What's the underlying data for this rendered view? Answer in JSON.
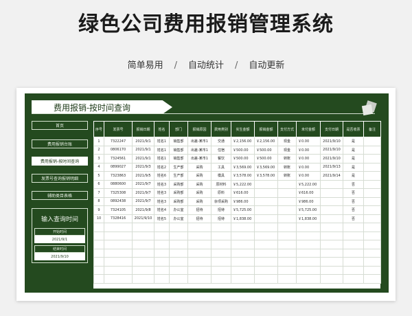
{
  "header": {
    "title": "绿色公司费用报销管理系统",
    "features": [
      "简单易用",
      "自动统计",
      "自动更新"
    ],
    "separator": "/"
  },
  "app": {
    "banner_title": "费用报销-按时间查询",
    "sidebar": {
      "items": [
        {
          "label": "首页",
          "active": false
        },
        {
          "label": "费用报销台账",
          "active": false
        },
        {
          "label": "费用报销-按时间查询",
          "active": true
        },
        {
          "label": "发票号查询报销明细",
          "active": false
        },
        {
          "label": "辅助类目表格",
          "active": false
        }
      ],
      "query": {
        "title": "输入查询时间",
        "start_label": "开始时间",
        "start_value": "2021/9/1",
        "end_label": "结束时间",
        "end_value": "2021/9/10"
      }
    },
    "table": {
      "headers": [
        "序号",
        "发票号",
        "报销日期",
        "姓名",
        "部门",
        "报销原因",
        "费用类别",
        "实生金额",
        "报销金额",
        "支付方式",
        "未付金额",
        "支付日期",
        "是否收票",
        "备注"
      ],
      "rows": [
        [
          "1",
          "7322247",
          "2021/9/1",
          "姓名1",
          "销售部",
          "出差-某市1",
          "交通",
          "￥2,156.00",
          "￥2,156.00",
          "现金",
          "￥0.00",
          "2021/9/10",
          "是",
          ""
        ],
        [
          "2",
          "0806170",
          "2021/9/1",
          "姓名1",
          "销售部",
          "出差-某市1",
          "住宿",
          "￥500.00",
          "￥500.00",
          "现金",
          "￥0.00",
          "2021/9/10",
          "是",
          ""
        ],
        [
          "3",
          "7324561",
          "2021/9/1",
          "姓名1",
          "销售部",
          "出差-某市1",
          "餐饮",
          "￥500.00",
          "￥500.00",
          "转账",
          "￥0.00",
          "2021/9/10",
          "是",
          ""
        ],
        [
          "4",
          "0899027",
          "2021/9/3",
          "姓名2",
          "生产部",
          "采购",
          "工具",
          "￥3,569.00",
          "￥3,569.00",
          "转账",
          "￥0.00",
          "2021/9/13",
          "是",
          ""
        ],
        [
          "5",
          "7323863",
          "2021/9/5",
          "姓名6",
          "生产部",
          "采购",
          "模具",
          "￥3,578.00",
          "￥3,578.00",
          "转账",
          "￥0.00",
          "2021/9/14",
          "是",
          ""
        ],
        [
          "6",
          "0880600",
          "2021/9/7",
          "姓名3",
          "采购部",
          "采购",
          "原材料",
          "￥5,222.00",
          "",
          "",
          "￥5,222.00",
          "",
          "否",
          ""
        ],
        [
          "7",
          "7325308",
          "2021/9/7",
          "姓名3",
          "采购部",
          "采购",
          "原料",
          "￥616.00",
          "",
          "",
          "￥616.00",
          "",
          "否",
          ""
        ],
        [
          "8",
          "0892438",
          "2021/9/7",
          "姓名3",
          "采购部",
          "采购",
          "杂项采购",
          "￥986.00",
          "",
          "",
          "￥986.00",
          "",
          "否",
          ""
        ],
        [
          "9",
          "7324105",
          "2021/9/8",
          "姓名4",
          "办公室",
          "招待",
          "招待",
          "￥5,725.00",
          "",
          "",
          "￥5,725.00",
          "",
          "否",
          ""
        ],
        [
          "10",
          "7328416",
          "2021/9/10",
          "姓名5",
          "办公室",
          "招待",
          "招待",
          "￥1,838.00",
          "",
          "",
          "￥1,838.00",
          "",
          "否",
          ""
        ]
      ],
      "blank_rows": 7
    },
    "colors": {
      "primary": "#244a1f",
      "page_bg": "#f1f1f1"
    },
    "icons": {
      "deco": "stacked-squares-icon"
    }
  }
}
